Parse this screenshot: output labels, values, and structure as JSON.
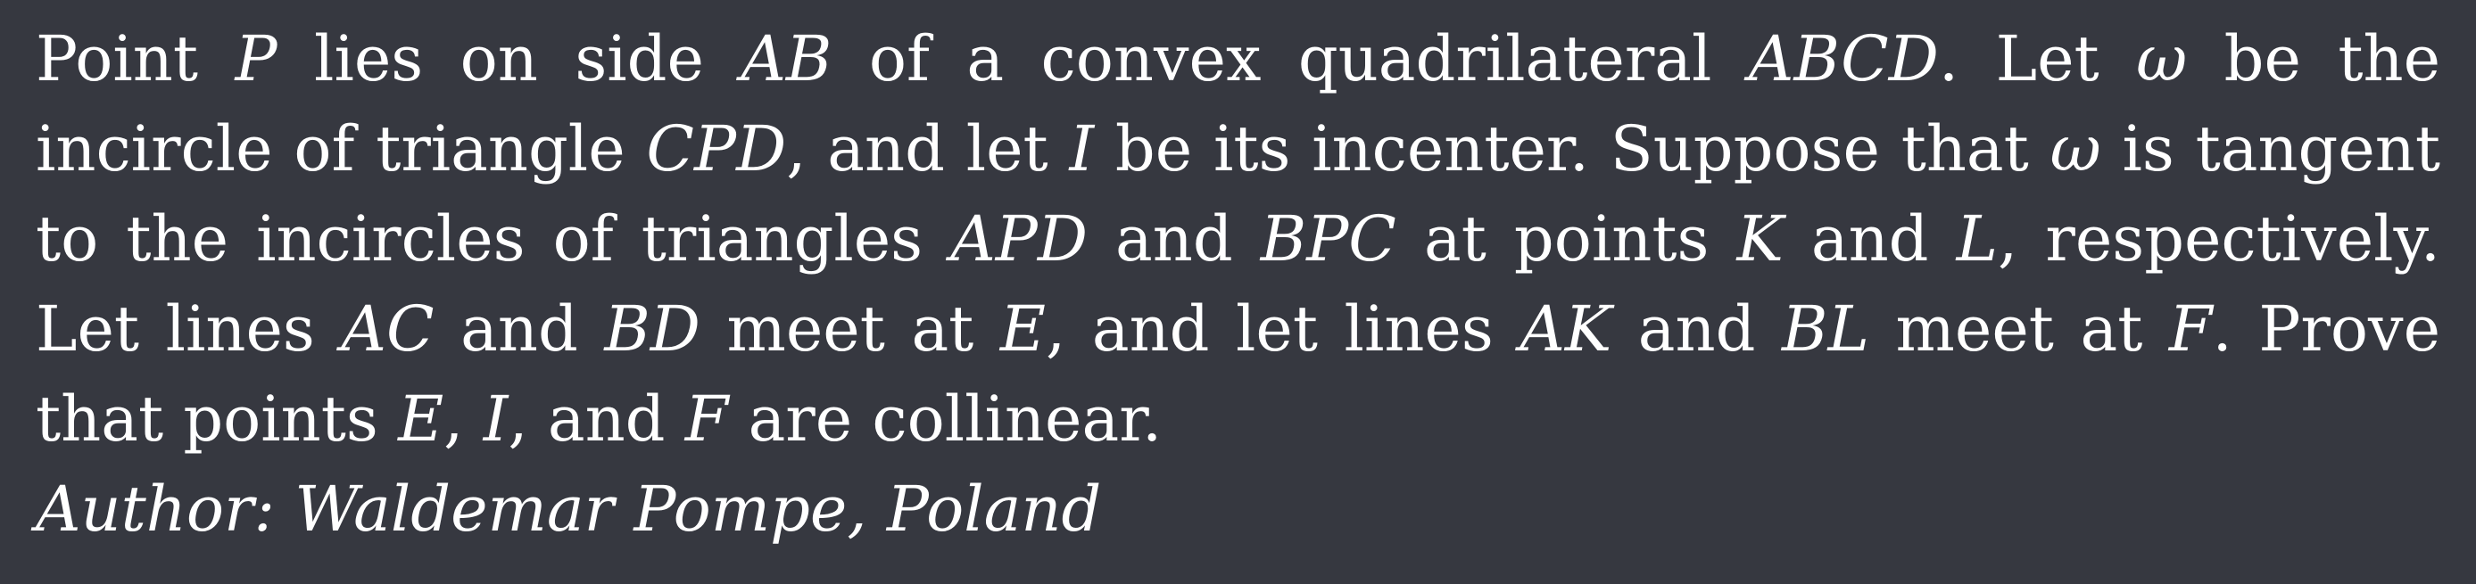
{
  "problem": {
    "lines": [
      [
        {
          "t": "Point "
        },
        {
          "t": "P",
          "m": true
        },
        {
          "t": " lies on side "
        },
        {
          "t": "AB",
          "m": true
        },
        {
          "t": " of a convex quadrilateral "
        },
        {
          "t": "ABCD",
          "m": true
        },
        {
          "t": ".  Let "
        },
        {
          "t": "ω",
          "m": true
        },
        {
          "t": " be the"
        }
      ],
      [
        {
          "t": "incircle of triangle "
        },
        {
          "t": "CPD",
          "m": true
        },
        {
          "t": ", and let "
        },
        {
          "t": "I",
          "m": true
        },
        {
          "t": " be its incenter. Suppose that "
        },
        {
          "t": "ω",
          "m": true
        },
        {
          "t": " is tangent"
        }
      ],
      [
        {
          "t": "to the incircles of triangles "
        },
        {
          "t": "APD",
          "m": true
        },
        {
          "t": " and "
        },
        {
          "t": "BPC",
          "m": true
        },
        {
          "t": " at points "
        },
        {
          "t": "K",
          "m": true
        },
        {
          "t": " and "
        },
        {
          "t": "L",
          "m": true
        },
        {
          "t": ", respectively."
        }
      ],
      [
        {
          "t": "Let lines "
        },
        {
          "t": "AC",
          "m": true
        },
        {
          "t": " and "
        },
        {
          "t": "BD",
          "m": true
        },
        {
          "t": " meet at "
        },
        {
          "t": "E",
          "m": true
        },
        {
          "t": ", and let lines "
        },
        {
          "t": "AK",
          "m": true
        },
        {
          "t": " and "
        },
        {
          "t": "BL",
          "m": true
        },
        {
          "t": " meet at "
        },
        {
          "t": "F",
          "m": true
        },
        {
          "t": ". Prove"
        }
      ],
      [
        {
          "t": "that points "
        },
        {
          "t": "E",
          "m": true
        },
        {
          "t": ", "
        },
        {
          "t": "I",
          "m": true
        },
        {
          "t": ", and "
        },
        {
          "t": "F",
          "m": true
        },
        {
          "t": " are collinear."
        }
      ]
    ],
    "author": "Author: Waldemar Pompe, Poland"
  },
  "colors": {
    "background": "#363840",
    "text": "#ffffff"
  }
}
